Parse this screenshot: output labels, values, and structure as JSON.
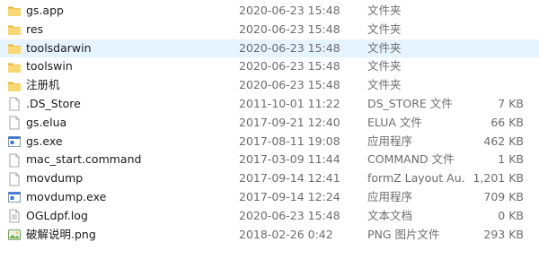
{
  "colors": {
    "selected_row": "#e5f3ff",
    "folder": "#f8d775",
    "secondary_text": "#6d6d6d"
  },
  "files": [
    {
      "name": "gs.app",
      "date": "2020-06-23 15:48",
      "type": "文件夹",
      "size": "",
      "icon": "folder-icon"
    },
    {
      "name": "res",
      "date": "2020-06-23 15:48",
      "type": "文件夹",
      "size": "",
      "icon": "folder-icon"
    },
    {
      "name": "toolsdarwin",
      "date": "2020-06-23 15:48",
      "type": "文件夹",
      "size": "",
      "icon": "folder-icon",
      "selected": true
    },
    {
      "name": "toolswin",
      "date": "2020-06-23 15:48",
      "type": "文件夹",
      "size": "",
      "icon": "folder-icon"
    },
    {
      "name": "注册机",
      "date": "2020-06-23 15:48",
      "type": "文件夹",
      "size": "",
      "icon": "folder-icon"
    },
    {
      "name": ".DS_Store",
      "date": "2011-10-01 11:22",
      "type": "DS_STORE 文件",
      "size": "7 KB",
      "icon": "file-icon"
    },
    {
      "name": "gs.elua",
      "date": "2017-09-21 12:40",
      "type": "ELUA 文件",
      "size": "66 KB",
      "icon": "file-icon"
    },
    {
      "name": "gs.exe",
      "date": "2017-08-11 19:08",
      "type": "应用程序",
      "size": "462 KB",
      "icon": "exe-icon"
    },
    {
      "name": "mac_start.command",
      "date": "2017-03-09 11:44",
      "type": "COMMAND 文件",
      "size": "1 KB",
      "icon": "file-icon"
    },
    {
      "name": "movdump",
      "date": "2017-09-14 12:41",
      "type": "formZ Layout Au...",
      "size": "1,201 KB",
      "icon": "file-icon"
    },
    {
      "name": "movdump.exe",
      "date": "2017-09-14 12:24",
      "type": "应用程序",
      "size": "709 KB",
      "icon": "exe-icon"
    },
    {
      "name": "OGLdpf.log",
      "date": "2020-06-23 15:48",
      "type": "文本文档",
      "size": "0 KB",
      "icon": "text-file-icon"
    },
    {
      "name": "破解说明.png",
      "date": "2018-02-26 0:42",
      "type": "PNG 图片文件",
      "size": "293 KB",
      "icon": "png-icon"
    }
  ]
}
